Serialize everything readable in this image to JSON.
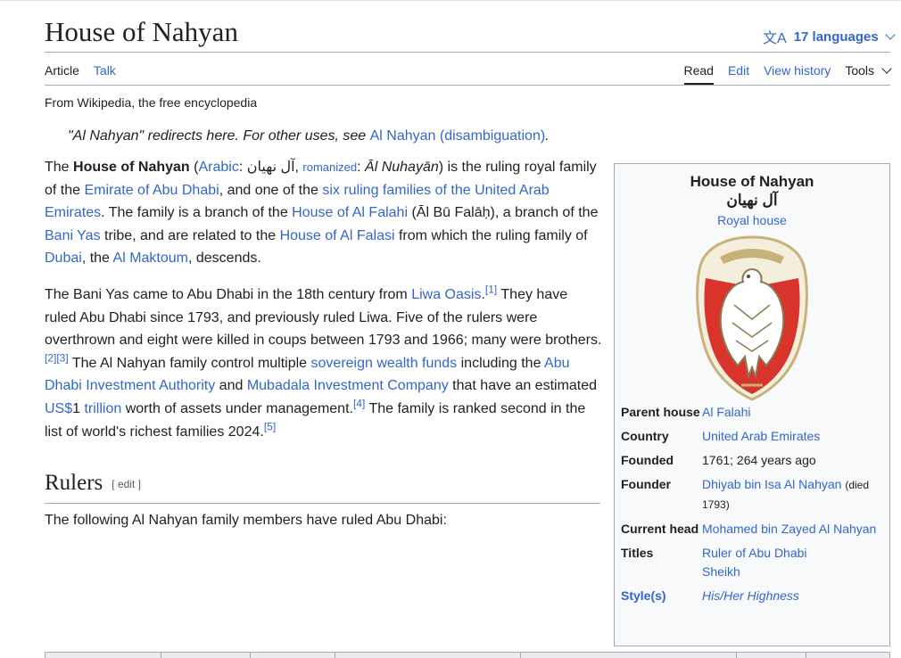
{
  "page": {
    "title": "House of Nahyan",
    "languages": "17 languages"
  },
  "tabs": {
    "article": "Article",
    "talk": "Talk",
    "read": "Read",
    "edit": "Edit",
    "view_history": "View history",
    "tools": "Tools"
  },
  "tagline": "From Wikipedia, the free encyclopedia",
  "hatnote": {
    "prefix": "\"Al Nahyan\" redirects here. For other uses, see ",
    "link": "Al Nahyan (disambiguation)",
    "suffix": "."
  },
  "para1": {
    "t1": "The ",
    "bold": "House of Nahyan",
    "t2": " (",
    "arabic_link": "Arabic",
    "t3": ": آل نهيان, ",
    "romanized_link": "romanized",
    "t4": ": ",
    "roman": "Āl Nuhayān",
    "t5": ") is the ruling royal family of the ",
    "l1": "Emirate of Abu Dhabi",
    "t6": ", and one of the ",
    "l2": "six ruling families of the United Arab Emirates",
    "t7": ". The family is a branch of the ",
    "l3": "House of Al Falahi",
    "t8": " (Āl Bū Falāḥ), a branch of the ",
    "l4": "Bani Yas",
    "t9": " tribe, and are related to the ",
    "l5": "House of Al Falasi",
    "t10": " from which the ruling family of ",
    "l6": "Dubai",
    "t11": ", the ",
    "l7": "Al Maktoum",
    "t12": ", descends."
  },
  "para2": {
    "t1": "The Bani Yas came to Abu Dhabi in the 18th century from ",
    "l1": "Liwa Oasis",
    "r1": "[1]",
    "t2": " They have ruled Abu Dhabi since 1793, and previously ruled Liwa. Five of the rulers were overthrown and eight were killed in coups between 1793 and 1966; many were brothers.",
    "r2": "[2]",
    "r3": "[3]",
    "t3": " The Al Nahyan family control multiple ",
    "l2": "sovereign wealth funds",
    "t4": " including the ",
    "l3": "Abu Dhabi Investment Authority",
    "t5": " and ",
    "l4": "Mubadala Investment Company",
    "t6": " that have an estimated ",
    "l5": "US$",
    "t7": "1 ",
    "l6": "trillion",
    "t8": " worth of assets under management.",
    "r4": "[4]",
    "t9": " The family is ranked second in the list of world's richest families 2024.",
    "r5": "[5]"
  },
  "rulers": {
    "heading": "Rulers",
    "edit": "[ edit ]",
    "intro": "The following Al Nahyan family members have ruled Abu Dhabi:"
  },
  "infobox": {
    "title": "House of Nahyan",
    "arabic": "آل نهيان",
    "subtitle": "Royal house",
    "crest_icon": "falcon-emblem-icon",
    "colors": {
      "gold": "#c9b27a",
      "red": "#d9342b"
    },
    "rows": [
      {
        "key": "Parent house",
        "value": "Al Falahi"
      },
      {
        "key": "Country",
        "value": "United Arab Emirates"
      },
      {
        "key": "Founded",
        "value": "1761; 264 years ago"
      },
      {
        "key": "Founder",
        "value": "Dhiyab bin Isa Al Nahyan",
        "note": "(died 1793)"
      },
      {
        "key": "Current head",
        "value": "Mohamed bin Zayed Al Nahyan"
      },
      {
        "key": "Titles",
        "value": "Ruler of Abu Dhabi",
        "value2": "Sheikh"
      },
      {
        "key": "Style(s)",
        "value": "His/Her Highness"
      }
    ]
  }
}
